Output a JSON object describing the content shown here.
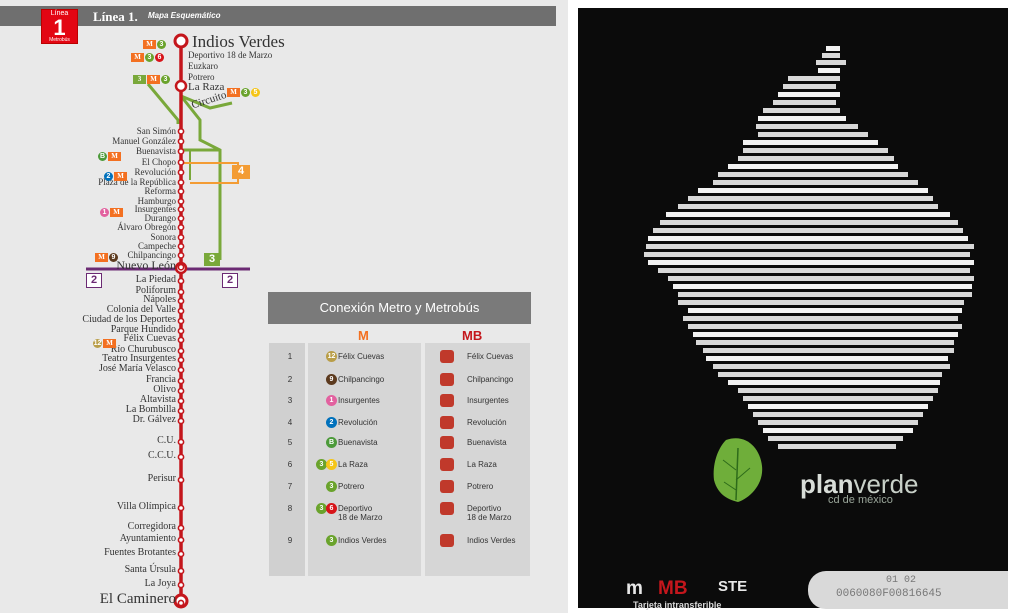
{
  "map": {
    "title": "Línea 1.",
    "subtitle": "Mapa Esquemático",
    "badge": {
      "top": "Línea",
      "num": "1",
      "bottom": "Metrobús"
    },
    "circuito_label": "Circuito",
    "route_color": "#c4161c",
    "stations_top": [
      {
        "name": "Indios Verdes"
      },
      {
        "name": "Deportivo 18 de Marzo"
      },
      {
        "name": "Euzkaro"
      },
      {
        "name": "Potrero"
      },
      {
        "name": "La Raza"
      }
    ],
    "stations_mid": [
      "San Simón",
      "Manuel González",
      "Buenavista",
      "El Chopo",
      "Revolución",
      "Plaza de la República",
      "Reforma",
      "Hamburgo",
      "Insurgentes",
      "Durango",
      "Álvaro Obregón",
      "Sonora",
      "Campeche",
      "Chilpancingo",
      "Nuevo León"
    ],
    "stations_low": [
      "La Piedad",
      "Poliforum",
      "Nápoles",
      "Colonia del Valle",
      "Ciudad de los Deportes",
      "Parque Hundido",
      "Félix Cuevas",
      "Río Churubusco",
      "Teatro Insurgentes",
      "José María Velasco",
      "Francia",
      "Olivo",
      "Altavista",
      "La Bombilla",
      "Dr. Gálvez"
    ],
    "stations_south": [
      "C.U.",
      "C.C.U.",
      "Perisur",
      "Villa Olímpica",
      "Corregidora",
      "Ayuntamiento",
      "Fuentes Brotantes",
      "Santa Úrsula",
      "La Joya",
      "El Caminero"
    ],
    "connections_badges": {
      "line2_left": "2",
      "line2_right": "2",
      "line3": "3",
      "line4": "4"
    }
  },
  "panel": {
    "title": "Conexión Metro y Metrobús",
    "metro_logo": "M",
    "mb_logo": "MB",
    "rows": [
      {
        "n": "1",
        "metro_lines": [
          "12"
        ],
        "metro_colors": [
          "#b99e48"
        ],
        "metro": "Félix Cuevas",
        "mb": "Félix Cuevas"
      },
      {
        "n": "2",
        "metro_lines": [
          "9"
        ],
        "metro_colors": [
          "#5c3a1e"
        ],
        "metro": "Chilpancingo",
        "mb": "Chilpancingo"
      },
      {
        "n": "3",
        "metro_lines": [
          "1"
        ],
        "metro_colors": [
          "#e2619f"
        ],
        "metro": "Insurgentes",
        "mb": "Insurgentes"
      },
      {
        "n": "4",
        "metro_lines": [
          "2"
        ],
        "metro_colors": [
          "#0071bc"
        ],
        "metro": "Revolución",
        "mb": "Revolución"
      },
      {
        "n": "5",
        "metro_lines": [
          "B"
        ],
        "metro_colors": [
          "#4c9a3a"
        ],
        "metro": "Buenavista",
        "mb": "Buenavista"
      },
      {
        "n": "6",
        "metro_lines": [
          "3",
          "5"
        ],
        "metro_colors": [
          "#6aa32c",
          "#f5c518"
        ],
        "metro": "La Raza",
        "mb": "La Raza"
      },
      {
        "n": "7",
        "metro_lines": [
          "3"
        ],
        "metro_colors": [
          "#6aa32c"
        ],
        "metro": "Potrero",
        "mb": "Potrero"
      },
      {
        "n": "8",
        "metro_lines": [
          "3",
          "6"
        ],
        "metro_colors": [
          "#6aa32c",
          "#d7141a"
        ],
        "metro": "Deportivo\n18 de Marzo",
        "mb": "Deportivo\n18 de Marzo"
      },
      {
        "n": "9",
        "metro_lines": [
          "3"
        ],
        "metro_colors": [
          "#6aa32c"
        ],
        "metro": "Indios Verdes",
        "mb": "Indios Verdes"
      }
    ]
  },
  "card": {
    "brand_plan": "plan",
    "brand_verde": "verde",
    "brand_sub": "cd de méxico",
    "tarjeta": "Tarjeta intransferible",
    "serial_top": "01 02",
    "serial": "0060080F00816645",
    "logos": [
      "m",
      "MB",
      "STE"
    ]
  }
}
